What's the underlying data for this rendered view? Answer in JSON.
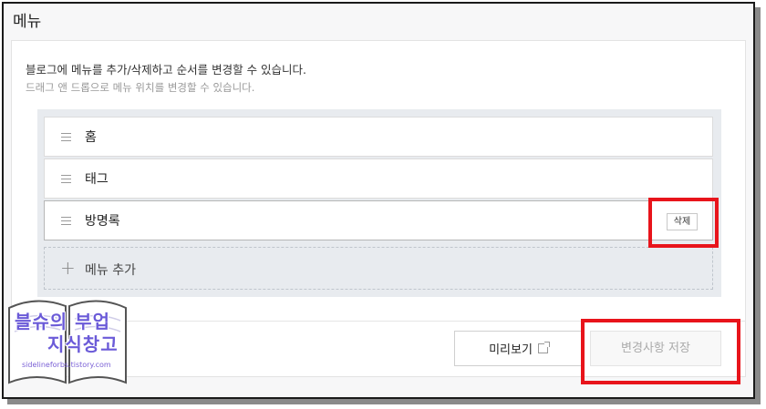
{
  "page": {
    "title": "메뉴"
  },
  "description": {
    "line1": "블로그에 메뉴를 추가/삭제하고 순서를 변경할 수 있습니다.",
    "line2": "드래그 앤 드롭으로 메뉴 위치를 변경할 수 있습니다."
  },
  "menu": {
    "items": [
      {
        "label": "홈"
      },
      {
        "label": "태그"
      },
      {
        "label": "방명록",
        "selected": true
      }
    ],
    "delete_label": "삭제",
    "add_label": "메뉴 추가"
  },
  "footer": {
    "preview_label": "미리보기",
    "save_label": "변경사항 저장"
  },
  "watermark": {
    "line1": "블슈의 부업",
    "line2": "지식창고",
    "url": "sidelineforbs.tistory.com"
  },
  "colors": {
    "highlight": "#e8141b",
    "watermark": "#6b5bd8"
  }
}
